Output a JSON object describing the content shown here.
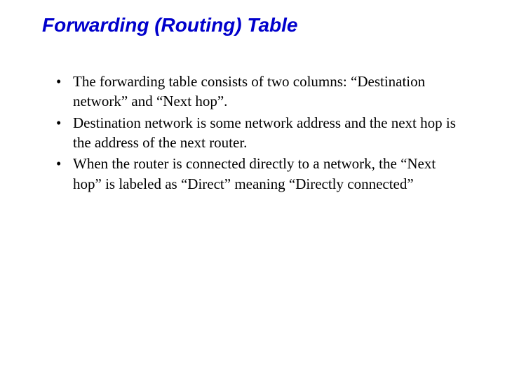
{
  "slide": {
    "title": "Forwarding (Routing) Table",
    "bullets": [
      "The forwarding table consists of two columns: “Destination network” and “Next hop”.",
      "Destination network is some network address and the next hop is the address of the next router.",
      "When the router is connected directly to a network, the “Next hop” is labeled as “Direct” meaning “Directly connected”"
    ]
  }
}
